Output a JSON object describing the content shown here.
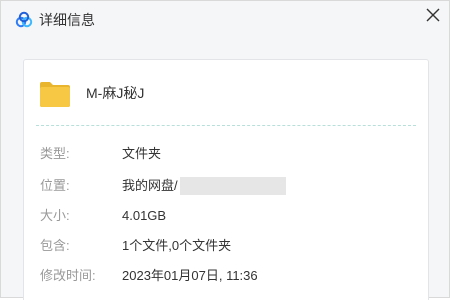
{
  "window": {
    "title": "详细信息",
    "close": "close"
  },
  "file": {
    "name": "M-麻J秘J",
    "icon": "folder-icon"
  },
  "details": [
    {
      "label": "类型:",
      "value": "文件夹"
    },
    {
      "label": "位置:",
      "value": "我的网盘/"
    },
    {
      "label": "大小:",
      "value": "4.01GB"
    },
    {
      "label": "包含:",
      "value": "1个文件,0个文件夹"
    },
    {
      "label": "修改时间:",
      "value": "2023年01月07日, 11:36"
    }
  ],
  "colors": {
    "folder": "#f6c843",
    "accent_blue": "#2e7cf6",
    "divider": "#b8e0da"
  }
}
